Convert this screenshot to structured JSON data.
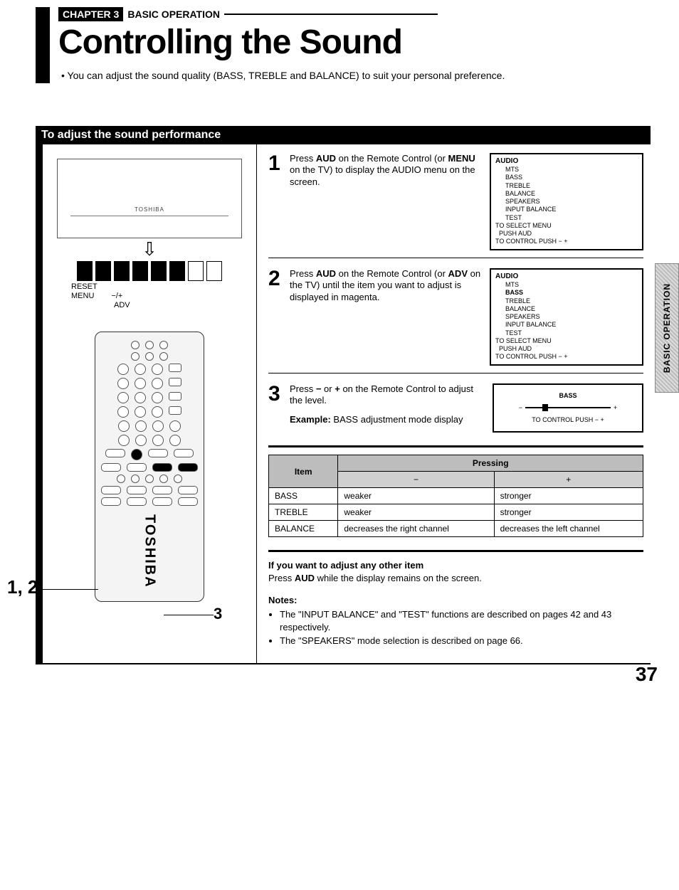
{
  "chapter": {
    "badge": "CHAPTER 3",
    "suffix": "BASIC OPERATION"
  },
  "page_title": "Controlling the Sound",
  "intro": "You can adjust the sound quality (BASS, TREBLE and BALANCE) to suit your personal preference.",
  "section_title": "To adjust the sound performance",
  "tv": {
    "brand": "TOSHIBA",
    "labels": {
      "reset": "RESET",
      "menu": "MENU",
      "adv": "ADV",
      "pm": "−/+"
    }
  },
  "remote": {
    "brand": "TOSHIBA"
  },
  "callouts": {
    "c12": "1, 2",
    "c3": "3"
  },
  "steps": [
    {
      "n": "1",
      "text_parts": [
        "Press ",
        "AUD",
        " on the Remote Control (or ",
        "MENU",
        " on the TV) to display the AUDIO menu on the screen."
      ],
      "osd": {
        "header": "AUDIO",
        "items": [
          "MTS",
          "BASS",
          "TREBLE",
          "BALANCE",
          "SPEAKERS",
          "INPUT BALANCE",
          "TEST"
        ],
        "highlight": -1,
        "foot1": "TO SELECT MENU",
        "foot2": "PUSH AUD",
        "foot3": "TO CONTROL PUSH − +"
      }
    },
    {
      "n": "2",
      "text_parts": [
        "Press ",
        "AUD",
        " on the Remote Control (or ",
        "ADV",
        " on the TV) until the item you want to adjust is displayed in magenta."
      ],
      "osd": {
        "header": "AUDIO",
        "items": [
          "MTS",
          "BASS",
          "TREBLE",
          "BALANCE",
          "SPEAKERS",
          "INPUT BALANCE",
          "TEST"
        ],
        "highlight": 1,
        "foot1": "TO SELECT MENU",
        "foot2": "PUSH AUD",
        "foot3": "TO CONTROL PUSH − +"
      }
    },
    {
      "n": "3",
      "text_parts": [
        "Press ",
        "−",
        " or ",
        "+",
        " on the Remote Control to adjust the level."
      ],
      "example_label": "Example:",
      "example_text": "BASS adjustment mode display",
      "osd_bass": {
        "label": "BASS",
        "minus": "−",
        "plus": "+",
        "foot": "TO CONTROL PUSH − +"
      }
    }
  ],
  "table": {
    "head_item": "Item",
    "head_press": "Pressing",
    "sub_minus": "−",
    "sub_plus": "+",
    "rows": [
      {
        "item": "BASS",
        "minus": "weaker",
        "plus": "stronger"
      },
      {
        "item": "TREBLE",
        "minus": "weaker",
        "plus": "stronger"
      },
      {
        "item": "BALANCE",
        "minus": "decreases the right channel",
        "plus": "decreases the left channel"
      }
    ]
  },
  "other": {
    "head": "If you want to adjust any other item",
    "body_parts": [
      "Press ",
      "AUD",
      " while the display remains on the screen."
    ]
  },
  "notes": {
    "head": "Notes:",
    "items": [
      "The \"INPUT BALANCE\" and \"TEST\" functions are described on pages 42 and 43 respectively.",
      "The \"SPEAKERS\" mode selection is described on page 66."
    ]
  },
  "side_tab": "BASIC OPERATION",
  "page_number": "37"
}
